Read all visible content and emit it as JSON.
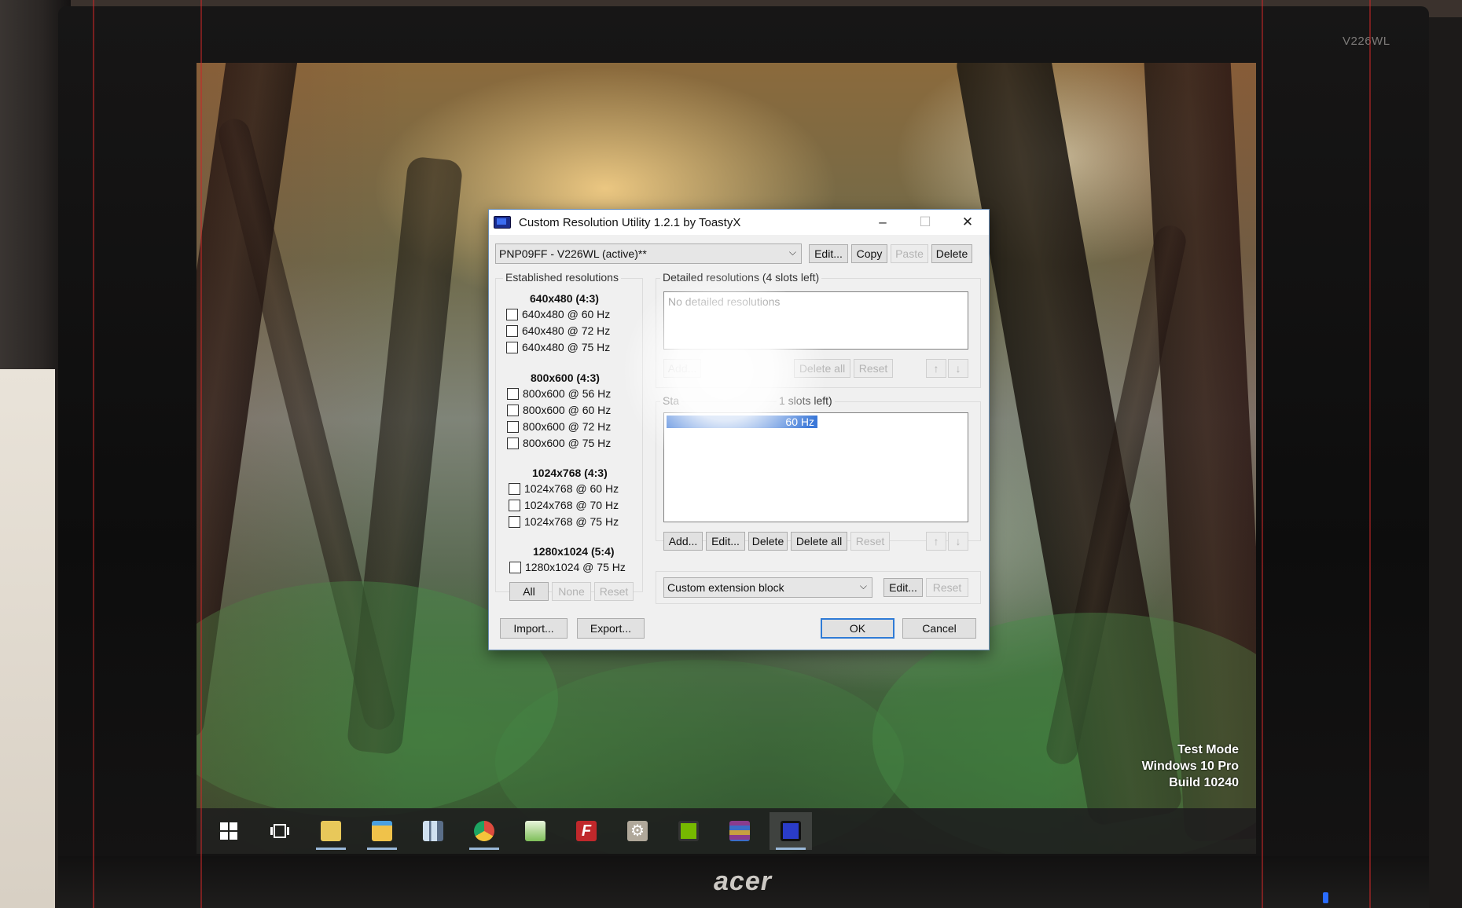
{
  "monitor": {
    "model_label": "V226WL",
    "brand": "acer"
  },
  "dialog": {
    "title": "Custom Resolution Utility 1.2.1 by ToastyX",
    "window_controls": {
      "minimize": "–",
      "maximize": "☐",
      "close": "✕"
    },
    "display_select": "PNP09FF - V226WL (active)**",
    "top_buttons": {
      "edit": "Edit...",
      "copy": "Copy",
      "paste": "Paste",
      "delete": "Delete"
    },
    "established": {
      "label": "Established resolutions",
      "groups": [
        {
          "heading": "640x480 (4:3)",
          "items": [
            "640x480 @ 60 Hz",
            "640x480 @ 72 Hz",
            "640x480 @ 75 Hz"
          ]
        },
        {
          "heading": "800x600 (4:3)",
          "items": [
            "800x600 @ 56 Hz",
            "800x600 @ 60 Hz",
            "800x600 @ 72 Hz",
            "800x600 @ 75 Hz"
          ]
        },
        {
          "heading": "1024x768 (4:3)",
          "items": [
            "1024x768 @ 60 Hz",
            "1024x768 @ 70 Hz",
            "1024x768 @ 75 Hz"
          ]
        },
        {
          "heading": "1280x1024 (5:4)",
          "items": [
            "1280x1024 @ 75 Hz"
          ]
        }
      ],
      "buttons": {
        "all": "All",
        "none": "None",
        "reset": "Reset"
      }
    },
    "detailed": {
      "label": "Detailed resolutions (4 slots left)",
      "placeholder": "No detailed resolutions",
      "buttons": {
        "add": "Add...",
        "delete_all": "Delete all",
        "reset": "Reset",
        "up": "↑",
        "down": "↓"
      }
    },
    "standard": {
      "label_start": "Sta",
      "label_end": "1 slots left)",
      "selected_item_tail": "60 Hz",
      "buttons": {
        "add": "Add...",
        "edit": "Edit...",
        "delete": "Delete",
        "delete_all": "Delete all",
        "reset": "Reset",
        "up": "↑",
        "down": "↓"
      }
    },
    "extension": {
      "select": "Custom extension block",
      "edit": "Edit...",
      "reset": "Reset"
    },
    "bottom_buttons": {
      "import": "Import...",
      "export": "Export...",
      "ok": "OK",
      "cancel": "Cancel"
    }
  },
  "desktop_watermark": {
    "line1": "Test Mode",
    "line2": "Windows 10 Pro",
    "line3": "Build 10240"
  },
  "taskbar": {
    "items": [
      {
        "icon": "windows-start-icon",
        "color": "#ffffff"
      },
      {
        "icon": "task-view-icon",
        "color": "#ffffff"
      },
      {
        "icon": "folder-yellow-icon",
        "color": "#e8c85a"
      },
      {
        "icon": "file-explorer-icon",
        "color": "#f0c24a"
      },
      {
        "icon": "library-icon",
        "color": "#cfe0f0"
      },
      {
        "icon": "chrome-icon",
        "color": "#dd4b3e"
      },
      {
        "icon": "notepad-icon",
        "color": "#7fbf5a"
      },
      {
        "icon": "filezilla-icon",
        "color": "#c0282b"
      },
      {
        "icon": "settings-gear-icon",
        "color": "#b0a89a"
      },
      {
        "icon": "nvidia-icon",
        "color": "#76b900"
      },
      {
        "icon": "winrar-icon",
        "color": "#8a3c8e"
      },
      {
        "icon": "monitor-cru-icon",
        "color": "#2a3cc8"
      }
    ]
  }
}
